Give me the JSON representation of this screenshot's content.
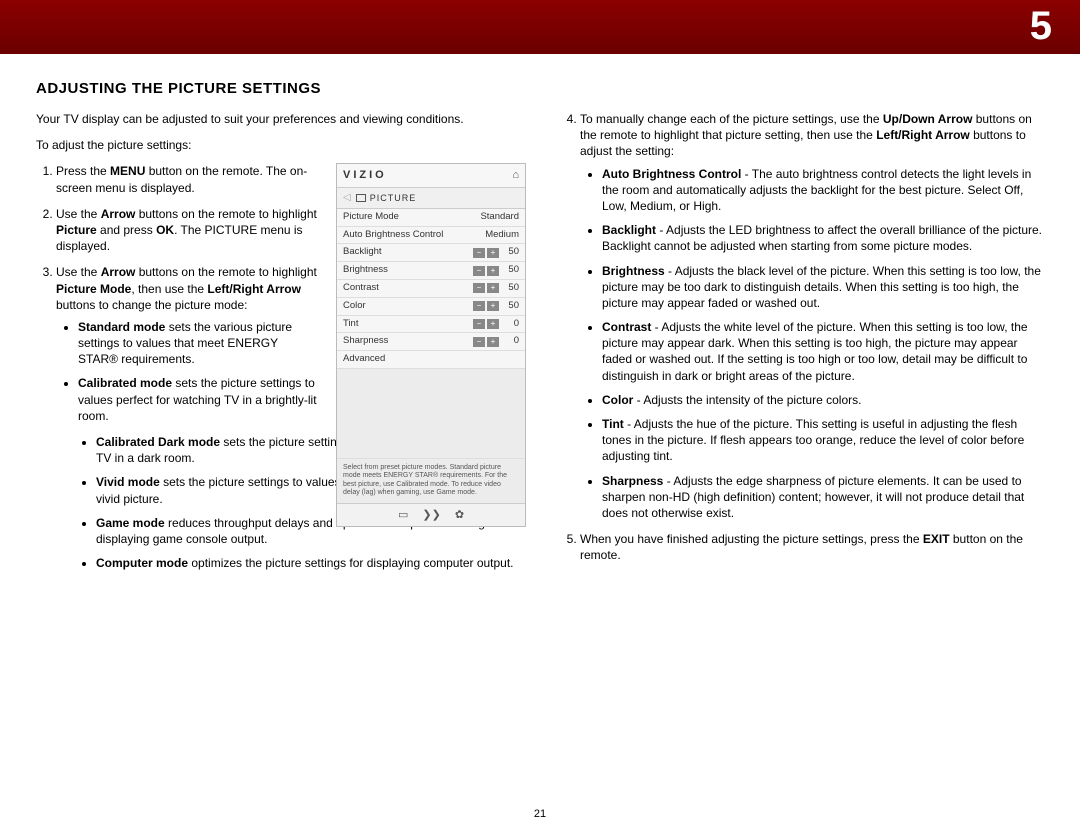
{
  "chapter": "5",
  "page_number": "21",
  "section_title": "ADJUSTING THE PICTURE SETTINGS",
  "intro": "Your TV display can be adjusted to suit your preferences and viewing conditions.",
  "lead_in": "To adjust the picture settings:",
  "left_steps": {
    "s1_a": "Press the ",
    "s1_menu": "MENU",
    "s1_b": " button on the remote. The on-screen menu is displayed.",
    "s2_a": "Use the ",
    "s2_arrow": "Arrow",
    "s2_b": " buttons on the remote to highlight ",
    "s2_picture": "Picture",
    "s2_c": " and press ",
    "s2_ok": "OK",
    "s2_d": ". The PICTURE menu is displayed.",
    "s3_a": "Use the ",
    "s3_arrow": "Arrow",
    "s3_b": " buttons on the remote to highlight ",
    "s3_pm": "Picture Mode",
    "s3_c": ", then use the ",
    "s3_lr": "Left/Right Arrow",
    "s3_d": " buttons to change the picture mode:"
  },
  "modes": {
    "std_b": "Standard mode",
    "std_t": " sets the various picture settings to values that meet ENERGY STAR® requirements.",
    "cal_b": "Calibrated mode",
    "cal_t": " sets the picture settings to values perfect for watching TV in a brightly-lit room.",
    "cald_b": "Calibrated Dark mode",
    "cald_t": " sets the picture settings to values perfect for watching TV in a dark room.",
    "viv_b": "Vivid mode",
    "viv_t": " sets the picture settings to values that produce a brighter, more vivid picture.",
    "game_b": "Game mode",
    "game_t": " reduces throughput delays and optimizes the picture settings for displaying game console output.",
    "comp_b": "Computer mode",
    "comp_t": " optimizes the picture settings for displaying computer output."
  },
  "right": {
    "s4_a": "To manually change each of the picture settings, use the ",
    "s4_ud": "Up/Down Arrow",
    "s4_b": " buttons on the remote to highlight that picture setting, then use the ",
    "s4_lr": "Left/Right Arrow",
    "s4_c": " buttons to adjust the setting:",
    "abc_b": "Auto Brightness Control",
    "abc_t": " - The auto brightness control detects the light levels in the room and automatically adjusts the backlight for the best picture. Select Off, Low, Medium, or High.",
    "bl_b": "Backlight",
    "bl_t": " - Adjusts the LED brightness to affect the overall brilliance of the picture. Backlight cannot be adjusted when starting from some picture modes.",
    "br_b": "Brightness",
    "br_t": " - Adjusts the black level of the picture. When this setting is too low, the picture may be too dark to distinguish details. When this setting is too high, the picture may appear faded or washed out.",
    "ct_b": "Contrast",
    "ct_t": " - Adjusts the white level of the picture. When this setting is too low, the picture may appear dark. When this setting is too high, the picture may appear faded or washed out. If the setting is too high or too low, detail may be difficult to distinguish in dark or bright areas of the picture.",
    "co_b": "Color",
    "co_t": " - Adjusts the intensity of the picture colors.",
    "ti_b": "Tint",
    "ti_t": " - Adjusts the hue of the picture. This setting is useful in adjusting the flesh tones in the picture. If flesh appears too orange, reduce the level of color before adjusting tint.",
    "sh_b": "Sharpness",
    "sh_t": " - Adjusts the edge sharpness of picture elements. It can be used to sharpen non-HD (high definition) content; however, it will not produce detail that does not otherwise exist.",
    "s5_a": "When you have finished adjusting the picture settings, press the ",
    "s5_exit": "EXIT",
    "s5_b": " button on the remote."
  },
  "osd": {
    "brand": "VIZIO",
    "title": "PICTURE",
    "rows": {
      "pm_l": "Picture Mode",
      "pm_v": "Standard",
      "abc_l": "Auto Brightness Control",
      "abc_v": "Medium",
      "bl_l": "Backlight",
      "bl_v": "50",
      "br_l": "Brightness",
      "br_v": "50",
      "ct_l": "Contrast",
      "ct_v": "50",
      "co_l": "Color",
      "co_v": "50",
      "ti_l": "Tint",
      "ti_v": "0",
      "sh_l": "Sharpness",
      "sh_v": "0",
      "adv": "Advanced"
    },
    "help": "Select from preset picture modes. Standard picture mode meets ENERGY STAR® requirements. For the best picture, use Calibrated mode. To reduce video delay (lag) when gaming, use Game mode."
  }
}
